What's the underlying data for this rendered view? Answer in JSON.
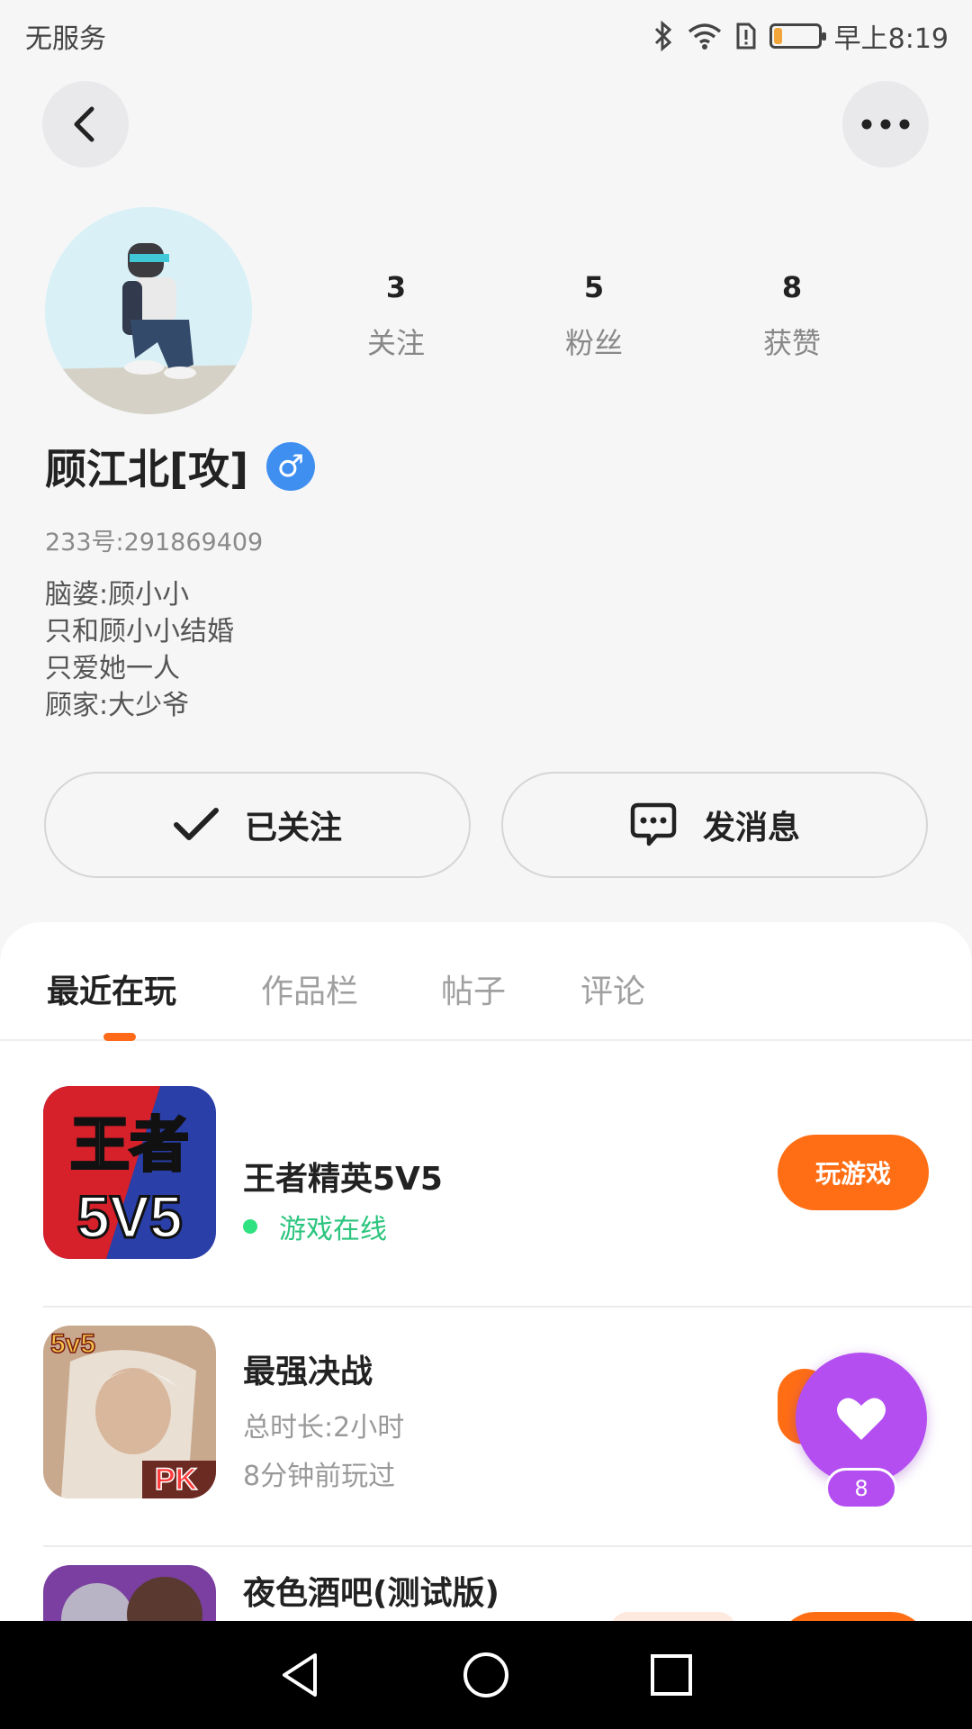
{
  "status_bar": {
    "carrier": "无服务",
    "time": "早上8:19",
    "battery_level": 0.18,
    "icons": [
      "bluetooth-icon",
      "wifi-icon",
      "sim-alert-icon",
      "battery-icon"
    ]
  },
  "header": {
    "back_icon": "chevron-left-icon",
    "more_icon": "more-dots-icon"
  },
  "profile": {
    "stats": [
      {
        "value": "3",
        "label": "关注"
      },
      {
        "value": "5",
        "label": "粉丝"
      },
      {
        "value": "8",
        "label": "获赞"
      }
    ],
    "username": "顾江北[攻]",
    "gender_symbol": "♂",
    "account_id": "233号:291869409",
    "bio_lines": [
      "脑婆:顾小小",
      "只和顾小小结婚",
      "只爱她一人",
      "顾家:大少爷"
    ],
    "follow_label": "已关注",
    "message_label": "发消息"
  },
  "tabs": [
    {
      "label": "最近在玩",
      "active": true
    },
    {
      "label": "作品栏",
      "active": false
    },
    {
      "label": "帖子",
      "active": false
    },
    {
      "label": "评论",
      "active": false
    }
  ],
  "games": [
    {
      "name": "王者精英5V5",
      "status": "游戏在线",
      "play_label": "玩游戏",
      "icon_text_top": "王者",
      "icon_text_bottom": "5V5"
    },
    {
      "name": "最强决战",
      "duration": "总时长:2小时",
      "last_played": "8分钟前玩过",
      "icon_badge_left": "5v5",
      "icon_badge_right": "PK"
    },
    {
      "name": "夜色酒吧(测试版)"
    }
  ],
  "like_float": {
    "count": "8"
  },
  "colors": {
    "accent": "#ff6e14",
    "like": "#b44ef0",
    "online": "#2cc57e",
    "gender": "#3f8ff0"
  }
}
